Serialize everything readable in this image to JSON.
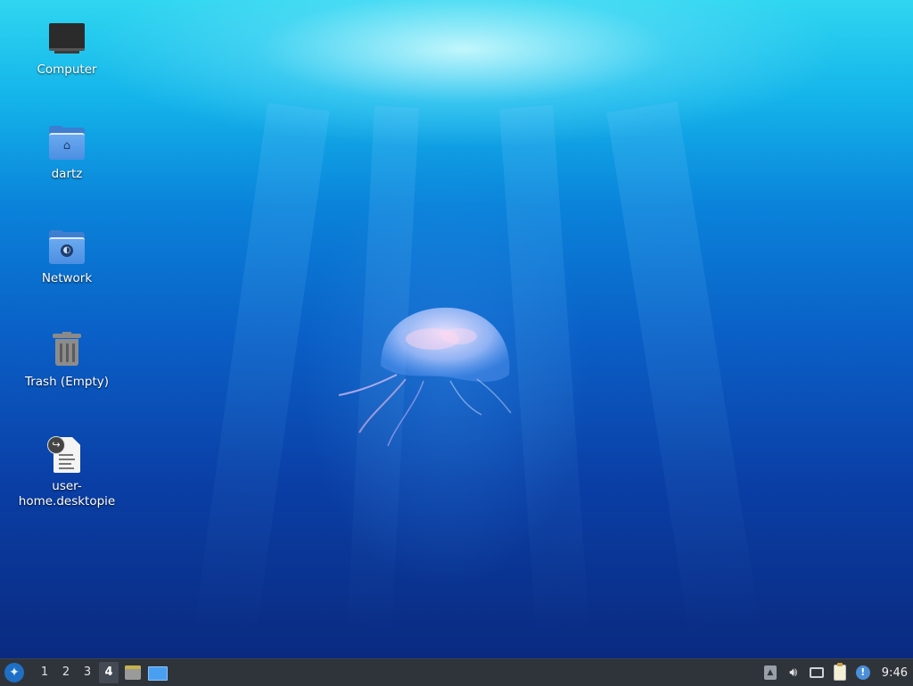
{
  "desktop": {
    "icons": [
      {
        "label": "Computer",
        "icon": "computer-icon"
      },
      {
        "label": "dartz",
        "icon": "home-folder-icon"
      },
      {
        "label": "Network",
        "icon": "network-folder-icon"
      },
      {
        "label": "Trash (Empty)",
        "icon": "trash-icon"
      },
      {
        "label": "user-\nhome.desktopie",
        "icon": "desktop-file-icon"
      }
    ]
  },
  "taskbar": {
    "start_icon": "lubuntu-menu-icon",
    "workspaces": [
      "1",
      "2",
      "3",
      "4"
    ],
    "active_workspace": "4",
    "launchers": [
      "file-manager-icon",
      "show-desktop-icon"
    ],
    "tray": [
      "eject-icon",
      "volume-icon",
      "network-icon",
      "clipboard-icon",
      "notification-icon"
    ],
    "clock": "9:46"
  },
  "colors": {
    "taskbar_bg": "#2f343b",
    "sea_top": "#2fd6f0",
    "sea_bottom": "#0a2a80",
    "folder_blue": "#4c8fe2"
  }
}
